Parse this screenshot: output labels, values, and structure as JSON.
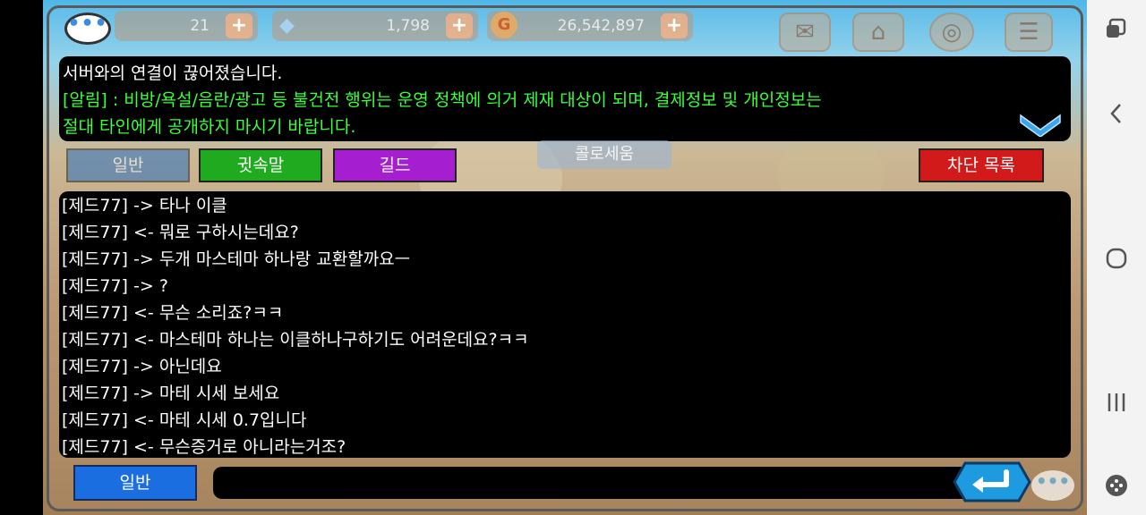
{
  "topbar": {
    "currencies": [
      {
        "name": "stamina",
        "value": "21"
      },
      {
        "name": "diamond",
        "value": "1,798"
      },
      {
        "name": "gold",
        "value": "26,542,897"
      }
    ],
    "plus_label": "+"
  },
  "notice": {
    "line1": "서버와의 연결이 끊어졌습니다.",
    "line2": "[알림] : 비방/욕설/음란/광고 등 불건전 행위는 운영 정책에 의거 제재 대상이 되며, 결제정보 및 개인정보는",
    "line3": "절대 타인에게 공개하지 마시기 바랍니다."
  },
  "tabs": {
    "general": "일반",
    "whisper": "귓속말",
    "guild": "길드",
    "blocklist": "차단 목록"
  },
  "background_label": "콜로세움",
  "messages": [
    "[제드77] -> 타나 이클",
    "[제드77] <- 뭐로 구하시는데요?",
    "[제드77] -> 두개 마스테마 하나랑 교환할까요ㅡ",
    "[제드77] -> ?",
    "[제드77] <- 무슨 소리죠?ㅋㅋ",
    "[제드77] <- 마스테마 하나는 이클하나구하기도 어려운데요?ㅋㅋ",
    "[제드77] -> 아닌데요",
    "[제드77] -> 마테 시세 보세요",
    "[제드77] <- 마테 시세 0.7입니다",
    "[제드77] <- 무슨증거로 아니라는거조?"
  ],
  "input": {
    "mode": "일반",
    "value": ""
  },
  "colors": {
    "notice_green": "#3aff3a",
    "tab_whisper": "#1faa1f",
    "tab_guild": "#a51fd0",
    "tab_block": "#d21a1a",
    "mode_button": "#1a6ee0"
  },
  "icons": [
    "chat-bubble-icon",
    "heart-icon",
    "diamond-icon",
    "gold-coin-icon",
    "mail-icon",
    "home-icon",
    "location-icon",
    "menu-icon",
    "chevron-down-icon",
    "enter-icon",
    "recent-apps-icon",
    "back-icon",
    "home-circle-icon",
    "recent-lines-icon",
    "gamepad-icon"
  ]
}
